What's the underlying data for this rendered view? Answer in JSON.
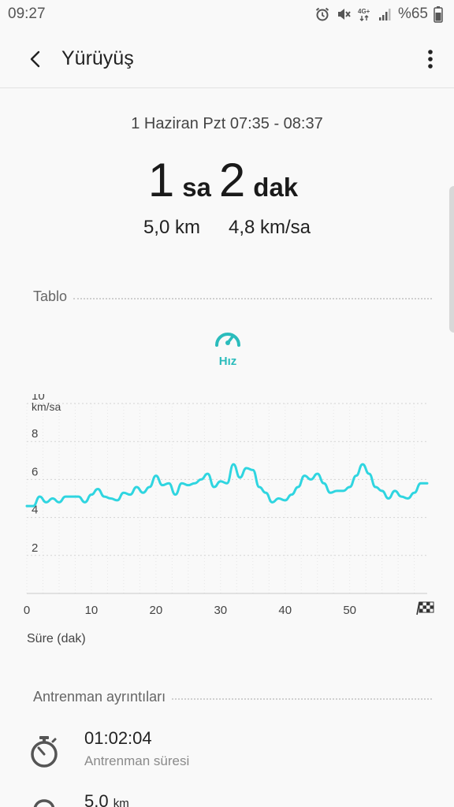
{
  "status_bar": {
    "time": "09:27",
    "network": "4G+",
    "battery": "%65"
  },
  "app_bar": {
    "title": "Yürüyüş"
  },
  "summary": {
    "date_range": "1 Haziran Pzt 07:35 - 08:37",
    "hours": "1",
    "hours_unit": "sa",
    "minutes": "2",
    "minutes_unit": "dak",
    "distance": "5,0 km",
    "avg_speed": "4,8 km/sa"
  },
  "chart_section": {
    "title": "Tablo",
    "tab_label": "Hız",
    "tab_icon": "speedometer-icon"
  },
  "chart_data": {
    "type": "line",
    "ylabel": "km/sa",
    "xlabel": "Süre (dak)",
    "ylim": [
      0,
      10
    ],
    "xlim": [
      0,
      62
    ],
    "y_ticks": [
      "2",
      "4",
      "6",
      "8",
      "10"
    ],
    "x_ticks": [
      "0",
      "10",
      "20",
      "30",
      "40",
      "50"
    ],
    "end_marker": "finish-flag-icon",
    "line_color": "#2fd5e0",
    "grid": true,
    "x": [
      0,
      1,
      2,
      3,
      4,
      5,
      6,
      7,
      8,
      9,
      10,
      11,
      12,
      13,
      14,
      15,
      16,
      17,
      18,
      19,
      20,
      21,
      22,
      23,
      24,
      25,
      26,
      27,
      28,
      29,
      30,
      31,
      32,
      33,
      34,
      35,
      36,
      37,
      38,
      39,
      40,
      41,
      42,
      43,
      44,
      45,
      46,
      47,
      48,
      49,
      50,
      51,
      52,
      53,
      54,
      55,
      56,
      57,
      58,
      59,
      60,
      61,
      62
    ],
    "values": [
      4.6,
      4.6,
      5.1,
      4.8,
      5.0,
      4.8,
      5.1,
      5.1,
      5.1,
      4.8,
      5.2,
      5.5,
      5.1,
      5.0,
      4.9,
      5.3,
      5.2,
      5.6,
      5.3,
      5.6,
      6.2,
      5.7,
      5.8,
      5.2,
      5.8,
      5.7,
      5.8,
      6.0,
      6.3,
      5.6,
      5.9,
      5.8,
      6.8,
      6.1,
      6.6,
      6.5,
      5.6,
      5.3,
      4.8,
      5.0,
      4.9,
      5.2,
      5.6,
      6.2,
      6.0,
      6.3,
      5.8,
      5.3,
      5.4,
      5.4,
      5.6,
      6.2,
      6.8,
      6.3,
      5.6,
      5.4,
      5.0,
      5.4,
      5.1,
      5.0,
      5.3,
      5.8,
      5.8
    ]
  },
  "details_section": {
    "title": "Antrenman ayrıntıları",
    "items": [
      {
        "value": "01:02:04",
        "unit": "",
        "label": "Antrenman süresi",
        "icon": "stopwatch-icon"
      },
      {
        "value": "5,0",
        "unit": "km",
        "label": "",
        "icon": "location-pin-icon"
      }
    ]
  }
}
